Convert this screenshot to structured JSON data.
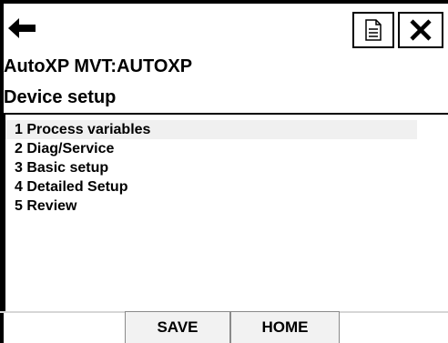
{
  "header": {
    "back_icon": "arrow-left-icon",
    "document_icon": "document-icon",
    "close_icon": "close-x-icon",
    "title": "AutoXP MVT:AUTOXP",
    "subtitle": "Device setup"
  },
  "menu": {
    "items": [
      {
        "label": "1 Process variables",
        "selected": true
      },
      {
        "label": "2 Diag/Service",
        "selected": false
      },
      {
        "label": "3 Basic setup",
        "selected": false
      },
      {
        "label": "4 Detailed Setup",
        "selected": false
      },
      {
        "label": "5 Review",
        "selected": false
      }
    ]
  },
  "footer": {
    "save_label": "SAVE",
    "home_label": "HOME"
  }
}
